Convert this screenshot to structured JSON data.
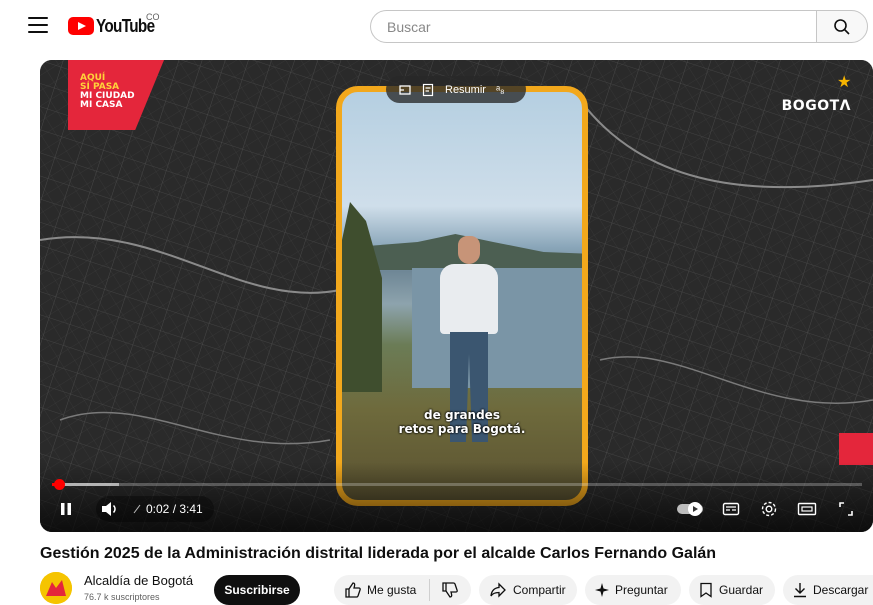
{
  "header": {
    "logo_text": "YouTube",
    "country_code": "CO",
    "search_placeholder": "Buscar"
  },
  "video": {
    "overlay_banner": [
      "AQUÍ",
      "SÍ PASA",
      "MI CIUDAD",
      "MI CASA"
    ],
    "brand": "BOGOTΛ",
    "pill_summarize": "Resumir",
    "subtitles": [
      "de grandes",
      "retos para Bogotá."
    ],
    "time": "0:02 / 3:41",
    "progress_fraction": 0.009
  },
  "title": "Gestión 2025 de la Administración distrital liderada por el alcalde Carlos Fernando Galán",
  "channel": {
    "name": "Alcaldía de Bogotá",
    "subscribers": "76.7 k suscriptores",
    "subscribe_label": "Suscribirse"
  },
  "actions": {
    "like": "Me gusta",
    "share": "Compartir",
    "ask": "Preguntar",
    "save": "Guardar",
    "download": "Descargar"
  },
  "colors": {
    "accent": "#ff0000",
    "frame": "#f2a81c",
    "banner": "#e4263b"
  }
}
